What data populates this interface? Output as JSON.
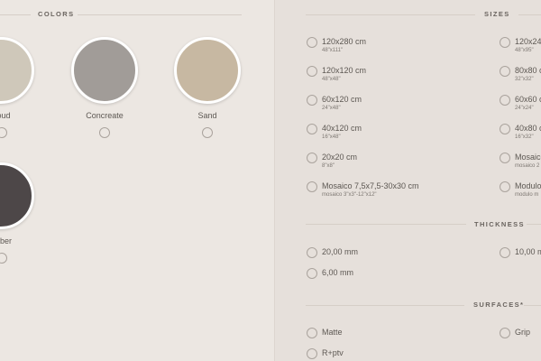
{
  "colors": {
    "title": "COLORS",
    "swatches": [
      {
        "label": "oud",
        "color": "#cfc8ba"
      },
      {
        "label": "Concreate",
        "color": "#a19c98"
      },
      {
        "label": "Sand",
        "color": "#c7b8a2"
      },
      {
        "label": "ober",
        "color": "#4d4748"
      }
    ]
  },
  "sizes": {
    "title": "SIZES",
    "left": [
      {
        "label": "120x280 cm",
        "sub": "48\"x111\""
      },
      {
        "label": "120x120 cm",
        "sub": "48\"x48\""
      },
      {
        "label": "60x120 cm",
        "sub": "24\"x48\""
      },
      {
        "label": "40x120 cm",
        "sub": "16\"x48\""
      },
      {
        "label": "20x20 cm",
        "sub": "8\"x8\""
      },
      {
        "label": "Mosaico 7,5x7,5-30x30 cm",
        "sub": "mosaico 3\"x3\"-12\"x12\""
      }
    ],
    "right": [
      {
        "label": "120x24",
        "sub": "48\"x95\""
      },
      {
        "label": "80x80 c",
        "sub": "32\"x32\""
      },
      {
        "label": "60x60 c",
        "sub": "24\"x24\""
      },
      {
        "label": "40x80 c",
        "sub": "16\"x32\""
      },
      {
        "label": "Mosaico",
        "sub": "mosaico 2"
      },
      {
        "label": "Modulo",
        "sub": "modulo m"
      }
    ]
  },
  "thickness": {
    "title": "THICKNESS",
    "left": [
      "20,00 mm",
      "6,00 mm"
    ],
    "right": [
      "10,00 m"
    ]
  },
  "surfaces": {
    "title": "SURFACES*",
    "left": [
      "Matte",
      "R+ptv"
    ],
    "right": [
      "Grip"
    ]
  }
}
